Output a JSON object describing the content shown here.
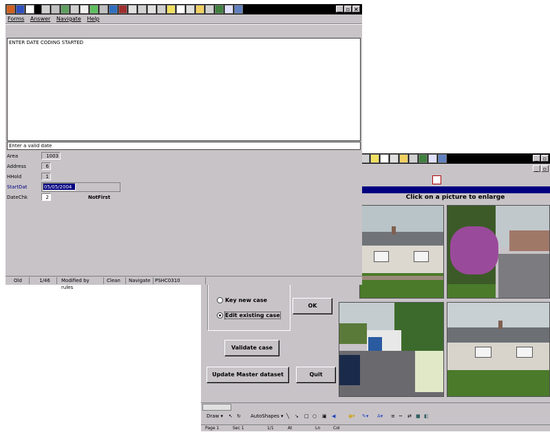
{
  "front": {
    "menu": [
      "Forms",
      "Answer",
      "Navigate",
      "Help"
    ],
    "message": "ENTER DATE CODING STARTED",
    "prompt": "Enter a valid date",
    "fields": [
      {
        "label": "Area",
        "value": "1003"
      },
      {
        "label": "Address",
        "value": "6"
      },
      {
        "label": "HHold",
        "value": "1"
      },
      {
        "label": "StartDat",
        "value": "05/05/2004"
      },
      {
        "label": "DateChk",
        "value": "2"
      }
    ],
    "datechk_note": "NotFirst",
    "status": [
      "Old",
      "1/46",
      "Modified by rules",
      "Clean",
      "Navigate",
      "PSHC0310"
    ]
  },
  "back": {
    "banner": "Click on a picture to enlarge",
    "radio_key_new": "Key new case",
    "radio_edit_existing": "Edit existing case",
    "ok_label": "OK",
    "validate_label": "Validate case",
    "update_label": "Update Master dataset",
    "quit_label": "Quit",
    "draw_label": "Draw",
    "autoshapes_label": "AutoShapes",
    "status": [
      "Page 1",
      "Sec 1",
      "1/1",
      "At",
      "Ln",
      "Col"
    ]
  },
  "colors": {
    "window_gray": "#c7c3c7",
    "titlebar": "#000000",
    "navy_bar": "#000080",
    "selection": "#000080"
  }
}
